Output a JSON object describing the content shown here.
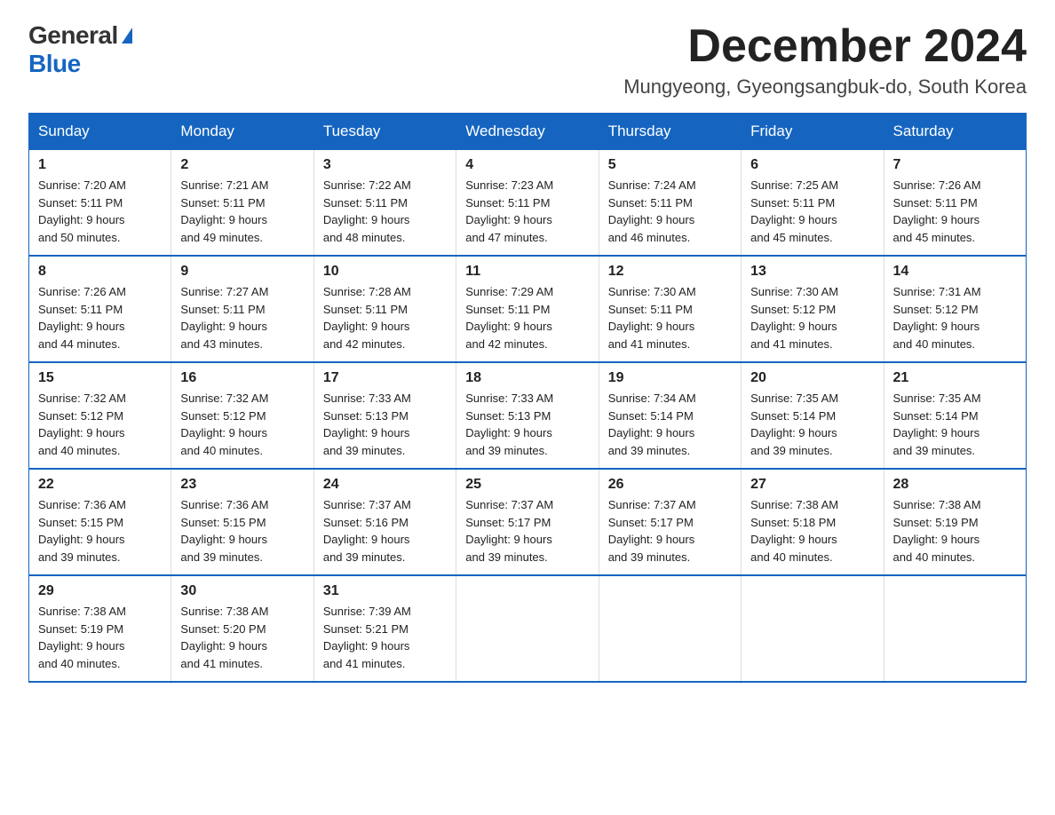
{
  "logo": {
    "general": "General",
    "blue": "Blue"
  },
  "header": {
    "month_year": "December 2024",
    "location": "Mungyeong, Gyeongsangbuk-do, South Korea"
  },
  "weekdays": [
    "Sunday",
    "Monday",
    "Tuesday",
    "Wednesday",
    "Thursday",
    "Friday",
    "Saturday"
  ],
  "weeks": [
    [
      {
        "day": "1",
        "sunrise": "7:20 AM",
        "sunset": "5:11 PM",
        "daylight": "9 hours and 50 minutes."
      },
      {
        "day": "2",
        "sunrise": "7:21 AM",
        "sunset": "5:11 PM",
        "daylight": "9 hours and 49 minutes."
      },
      {
        "day": "3",
        "sunrise": "7:22 AM",
        "sunset": "5:11 PM",
        "daylight": "9 hours and 48 minutes."
      },
      {
        "day": "4",
        "sunrise": "7:23 AM",
        "sunset": "5:11 PM",
        "daylight": "9 hours and 47 minutes."
      },
      {
        "day": "5",
        "sunrise": "7:24 AM",
        "sunset": "5:11 PM",
        "daylight": "9 hours and 46 minutes."
      },
      {
        "day": "6",
        "sunrise": "7:25 AM",
        "sunset": "5:11 PM",
        "daylight": "9 hours and 45 minutes."
      },
      {
        "day": "7",
        "sunrise": "7:26 AM",
        "sunset": "5:11 PM",
        "daylight": "9 hours and 45 minutes."
      }
    ],
    [
      {
        "day": "8",
        "sunrise": "7:26 AM",
        "sunset": "5:11 PM",
        "daylight": "9 hours and 44 minutes."
      },
      {
        "day": "9",
        "sunrise": "7:27 AM",
        "sunset": "5:11 PM",
        "daylight": "9 hours and 43 minutes."
      },
      {
        "day": "10",
        "sunrise": "7:28 AM",
        "sunset": "5:11 PM",
        "daylight": "9 hours and 42 minutes."
      },
      {
        "day": "11",
        "sunrise": "7:29 AM",
        "sunset": "5:11 PM",
        "daylight": "9 hours and 42 minutes."
      },
      {
        "day": "12",
        "sunrise": "7:30 AM",
        "sunset": "5:11 PM",
        "daylight": "9 hours and 41 minutes."
      },
      {
        "day": "13",
        "sunrise": "7:30 AM",
        "sunset": "5:12 PM",
        "daylight": "9 hours and 41 minutes."
      },
      {
        "day": "14",
        "sunrise": "7:31 AM",
        "sunset": "5:12 PM",
        "daylight": "9 hours and 40 minutes."
      }
    ],
    [
      {
        "day": "15",
        "sunrise": "7:32 AM",
        "sunset": "5:12 PM",
        "daylight": "9 hours and 40 minutes."
      },
      {
        "day": "16",
        "sunrise": "7:32 AM",
        "sunset": "5:12 PM",
        "daylight": "9 hours and 40 minutes."
      },
      {
        "day": "17",
        "sunrise": "7:33 AM",
        "sunset": "5:13 PM",
        "daylight": "9 hours and 39 minutes."
      },
      {
        "day": "18",
        "sunrise": "7:33 AM",
        "sunset": "5:13 PM",
        "daylight": "9 hours and 39 minutes."
      },
      {
        "day": "19",
        "sunrise": "7:34 AM",
        "sunset": "5:14 PM",
        "daylight": "9 hours and 39 minutes."
      },
      {
        "day": "20",
        "sunrise": "7:35 AM",
        "sunset": "5:14 PM",
        "daylight": "9 hours and 39 minutes."
      },
      {
        "day": "21",
        "sunrise": "7:35 AM",
        "sunset": "5:14 PM",
        "daylight": "9 hours and 39 minutes."
      }
    ],
    [
      {
        "day": "22",
        "sunrise": "7:36 AM",
        "sunset": "5:15 PM",
        "daylight": "9 hours and 39 minutes."
      },
      {
        "day": "23",
        "sunrise": "7:36 AM",
        "sunset": "5:15 PM",
        "daylight": "9 hours and 39 minutes."
      },
      {
        "day": "24",
        "sunrise": "7:37 AM",
        "sunset": "5:16 PM",
        "daylight": "9 hours and 39 minutes."
      },
      {
        "day": "25",
        "sunrise": "7:37 AM",
        "sunset": "5:17 PM",
        "daylight": "9 hours and 39 minutes."
      },
      {
        "day": "26",
        "sunrise": "7:37 AM",
        "sunset": "5:17 PM",
        "daylight": "9 hours and 39 minutes."
      },
      {
        "day": "27",
        "sunrise": "7:38 AM",
        "sunset": "5:18 PM",
        "daylight": "9 hours and 40 minutes."
      },
      {
        "day": "28",
        "sunrise": "7:38 AM",
        "sunset": "5:19 PM",
        "daylight": "9 hours and 40 minutes."
      }
    ],
    [
      {
        "day": "29",
        "sunrise": "7:38 AM",
        "sunset": "5:19 PM",
        "daylight": "9 hours and 40 minutes."
      },
      {
        "day": "30",
        "sunrise": "7:38 AM",
        "sunset": "5:20 PM",
        "daylight": "9 hours and 41 minutes."
      },
      {
        "day": "31",
        "sunrise": "7:39 AM",
        "sunset": "5:21 PM",
        "daylight": "9 hours and 41 minutes."
      },
      {
        "day": "",
        "sunrise": "",
        "sunset": "",
        "daylight": ""
      },
      {
        "day": "",
        "sunrise": "",
        "sunset": "",
        "daylight": ""
      },
      {
        "day": "",
        "sunrise": "",
        "sunset": "",
        "daylight": ""
      },
      {
        "day": "",
        "sunrise": "",
        "sunset": "",
        "daylight": ""
      }
    ]
  ],
  "labels": {
    "sunrise": "Sunrise: ",
    "sunset": "Sunset: ",
    "daylight": "Daylight: "
  }
}
